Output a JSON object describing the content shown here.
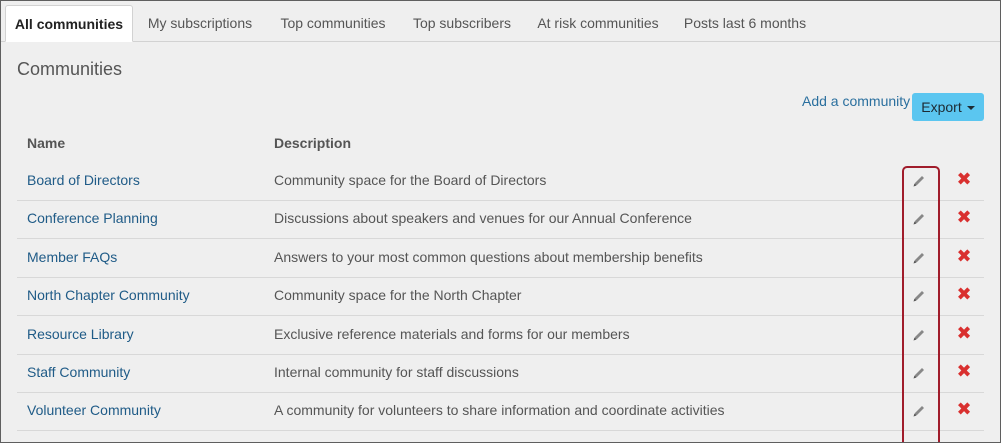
{
  "tabs": [
    {
      "label": "All communities",
      "active": true
    },
    {
      "label": "My subscriptions",
      "active": false
    },
    {
      "label": "Top communities",
      "active": false
    },
    {
      "label": "Top subscribers",
      "active": false
    },
    {
      "label": "At risk communities",
      "active": false
    },
    {
      "label": "Posts last 6 months",
      "active": false
    }
  ],
  "page": {
    "title": "Communities"
  },
  "toolbar": {
    "add_label": "Add a community",
    "export_label": "Export"
  },
  "table": {
    "headers": {
      "name": "Name",
      "description": "Description"
    },
    "rows": [
      {
        "name": "Board of Directors",
        "description": "Community space for the Board of Directors"
      },
      {
        "name": "Conference Planning",
        "description": "Discussions about speakers and venues for our Annual Conference"
      },
      {
        "name": "Member FAQs",
        "description": "Answers to your most common questions about membership benefits"
      },
      {
        "name": "North Chapter Community",
        "description": "Community space for the North Chapter"
      },
      {
        "name": "Resource Library",
        "description": "Exclusive reference materials and forms for our members"
      },
      {
        "name": "Staff Community",
        "description": "Internal community for staff discussions"
      },
      {
        "name": "Volunteer Community",
        "description": "A community for volunteers to share information and coordinate activities"
      }
    ]
  },
  "icons": {
    "edit": "pencil-icon",
    "delete": "red-x-icon"
  },
  "colors": {
    "accent_button": "#5bc6f0",
    "link": "#1f5b87",
    "delete": "#d9302f",
    "highlight_box": "#a01c2b"
  }
}
